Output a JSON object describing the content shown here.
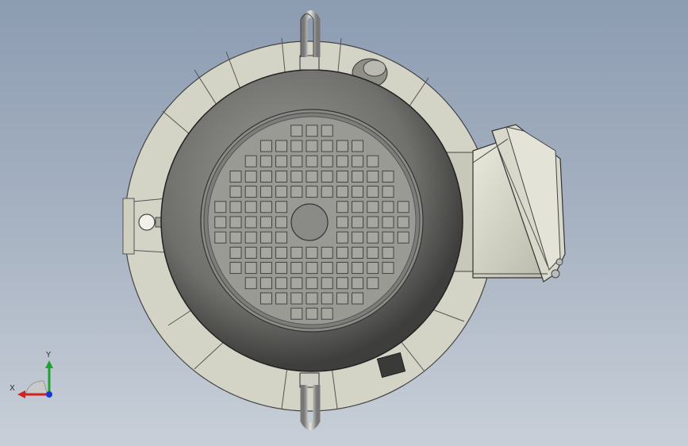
{
  "viewport": {
    "background_top": "#8c9cb1",
    "background_bottom": "#c8cfd8"
  },
  "model": {
    "view": "front",
    "fan_grid": {
      "rows": 13,
      "cols": 13
    }
  },
  "triad": {
    "x_label": "X",
    "y_label": "Y",
    "x_color": "#d42020",
    "y_color": "#1fa32e",
    "z_color": "#1a36d8"
  },
  "icons": [
    "lifting-eye-icon",
    "terminal-box-icon",
    "drain-plug-icon",
    "coordinate-triad-icon"
  ]
}
